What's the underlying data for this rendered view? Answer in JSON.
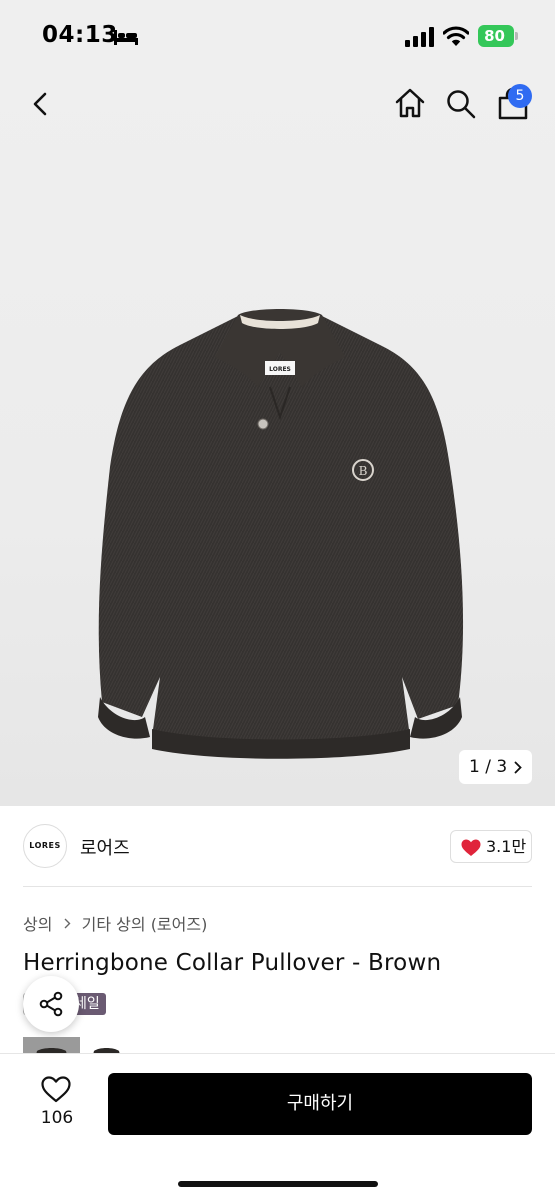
{
  "status_bar": {
    "time": "04:13",
    "battery": "80",
    "icons": [
      "bed-icon",
      "signal-icon",
      "wifi-icon",
      "battery-icon"
    ]
  },
  "nav": {
    "icons": [
      "chevron-left-icon",
      "home-icon",
      "search-icon",
      "shopping-bag-icon"
    ],
    "cart_count": "5"
  },
  "gallery": {
    "counter": "1 / 3",
    "label_brand": "LORES",
    "emblem_letter": "B"
  },
  "brand": {
    "logo_text": "LORES",
    "name": "로어즈",
    "likes": "3.1만"
  },
  "product": {
    "breadcrumb": [
      "상의",
      "기타 상의 (로어즈)"
    ],
    "title": "Herringbone Collar Pullover - Brown",
    "tag": "세일"
  },
  "bottom_bar": {
    "wishlist_count": "106",
    "buy_label": "구매하기"
  },
  "colors": {
    "accent": "#2f6bf2",
    "heart": "#e0243b",
    "battery": "#34c759",
    "buy_button": "#000000",
    "sale_tag": "#6a5a72"
  }
}
